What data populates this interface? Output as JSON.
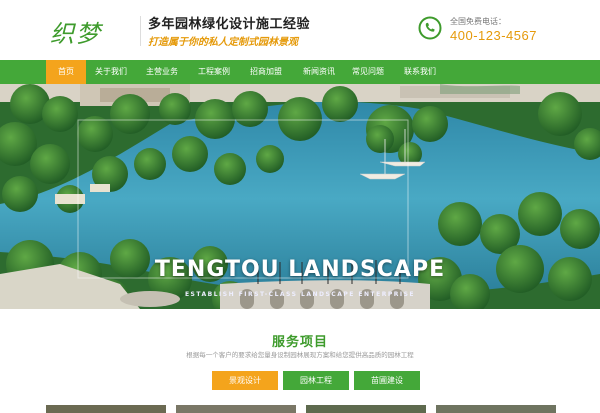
{
  "header": {
    "logo": "织梦",
    "slogan_main": "多年园林绿化设计施工经验",
    "slogan_sub": "打造属于你的私人定制式园林景观",
    "phone_label": "全国免费电话：",
    "phone_number": "400-123-4567",
    "phone_icon": "phone-icon"
  },
  "nav": {
    "items": [
      "首页",
      "关于我们",
      "主营业务",
      "工程案例",
      "招商加盟",
      "新闻资讯",
      "常见问题",
      "联系我们"
    ],
    "active_index": 0
  },
  "banner": {
    "title": "TENGTOU LANDSCAPE",
    "subtitle": "ESTABLISH FIRST-CLASS LANDSCAPE ENTERPRISE"
  },
  "services": {
    "title": "服务项目",
    "desc": "根据每一个客户的要求给您量身设制园林展现方案和给您提供高品质的园林工程",
    "buttons": [
      "景观设计",
      "园林工程",
      "苗圃建设"
    ]
  },
  "colors": {
    "brand_green": "#44a839",
    "accent_orange": "#f4a41c"
  }
}
